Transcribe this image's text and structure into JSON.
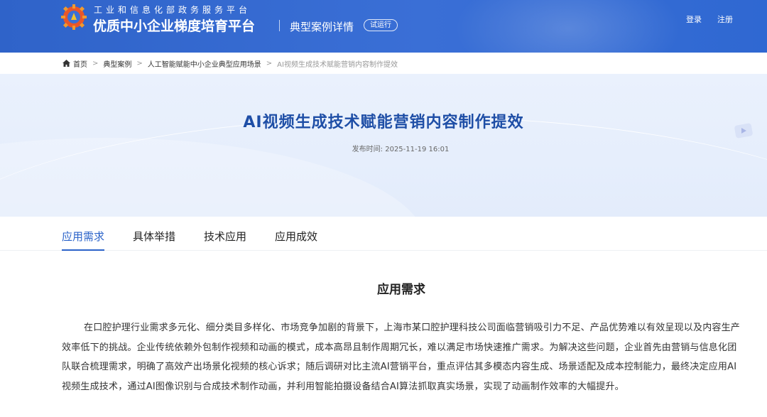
{
  "header": {
    "platform_tagline": "工业和信息化部政务服务平台",
    "platform_name": "优质中小企业梯度培育平台",
    "page_section": "典型案例详情",
    "trial_badge": "试运行",
    "login": "登录",
    "register": "注册"
  },
  "breadcrumb": {
    "items": [
      "首页",
      "典型案例",
      "人工智能赋能中小企业典型应用场景",
      "AI视频生成技术赋能营销内容制作提效"
    ],
    "separator": ">"
  },
  "article": {
    "title": "AI视频生成技术赋能营销内容制作提效",
    "publish_label": "发布时间:",
    "publish_time": "2025-11-19 16:01"
  },
  "tabs": [
    {
      "label": "应用需求",
      "active": true
    },
    {
      "label": "具体举措",
      "active": false
    },
    {
      "label": "技术应用",
      "active": false
    },
    {
      "label": "应用成效",
      "active": false
    }
  ],
  "section": {
    "title": "应用需求",
    "paragraph": "在口腔护理行业需求多元化、细分类目多样化、市场竞争加剧的背景下，上海市某口腔护理科技公司面临营销吸引力不足、产品优势难以有效呈现以及内容生产效率低下的挑战。企业传统依赖外包制作视频和动画的模式，成本高昂且制作周期冗长，难以满足市场快速推广需求。为解决这些问题，企业首先由营销与信息化团队联合梳理需求，明确了高效产出场景化视频的核心诉求；随后调研对比主流AI营销平台，重点评估其多模态内容生成、场景适配及成本控制能力，最终决定应用AI视频生成技术，通过AI图像识别与合成技术制作动画，并利用智能拍摄设备结合AI算法抓取真实场景，实现了动画制作效率的大幅提升。"
  },
  "colors": {
    "header_blue": "#3a6fd6",
    "accent_blue": "#2b63c9",
    "title_blue": "#1e4ea6"
  },
  "icons": [
    "gear-logo-icon",
    "home-icon",
    "play-icon"
  ]
}
